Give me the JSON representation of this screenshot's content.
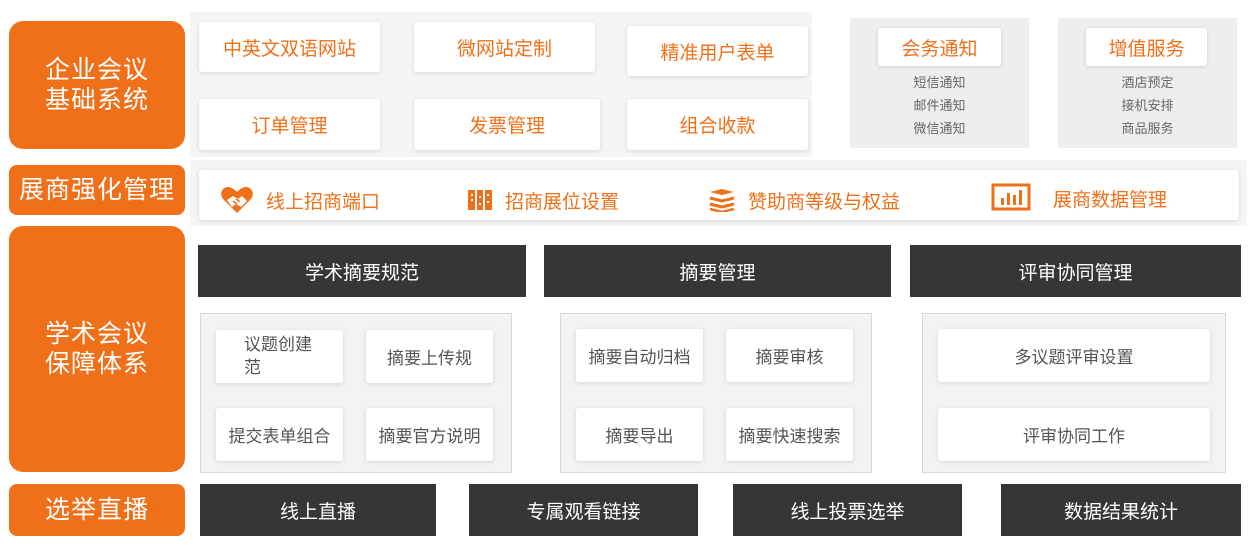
{
  "colors": {
    "accent": "#f07019",
    "dark_bar": "#363636",
    "panel": "#eeeeee"
  },
  "categories": {
    "enterprise": {
      "line1": "企业会议",
      "line2": "基础系统"
    },
    "exhibitor": {
      "label": "展商强化管理"
    },
    "academic": {
      "line1": "学术会议",
      "line2": "保障体系"
    },
    "election": {
      "label": "选举直播"
    }
  },
  "enterprise": {
    "cards": [
      "中英文双语网站",
      "微网站定制",
      "精准用户表单",
      "订单管理",
      "发票管理",
      "组合收款"
    ],
    "meeting_notice": {
      "title": "会务通知",
      "items": [
        "短信通知",
        "邮件通知",
        "微信通知"
      ]
    },
    "value_added": {
      "title": "增值服务",
      "items": [
        "酒店预定",
        "接机安排",
        "商品服务"
      ]
    }
  },
  "exhibitor": {
    "items": [
      {
        "label": "线上招商端口",
        "icon": "handshake-icon"
      },
      {
        "label": "招商展位设置",
        "icon": "booth-map-icon"
      },
      {
        "label": "赞助商等级与权益",
        "icon": "layers-icon"
      },
      {
        "label": "展商数据管理",
        "icon": "bar-chart-icon"
      }
    ]
  },
  "academic": {
    "headers": [
      "学术摘要规范",
      "摘要管理",
      "评审协同管理"
    ],
    "group1": [
      "议题创建规范",
      "摘要上传规",
      "提交表单组合",
      "摘要官方说明"
    ],
    "group1_wrap": {
      "line1": "议题创建",
      "line2": "范"
    },
    "group2": [
      "摘要自动归档",
      "摘要审核",
      "摘要导出",
      "摘要快速搜索"
    ],
    "group3": [
      "多议题评审设置",
      "评审协同工作"
    ]
  },
  "election": {
    "items": [
      "线上直播",
      "专属观看链接",
      "线上投票选举",
      "数据结果统计"
    ]
  }
}
